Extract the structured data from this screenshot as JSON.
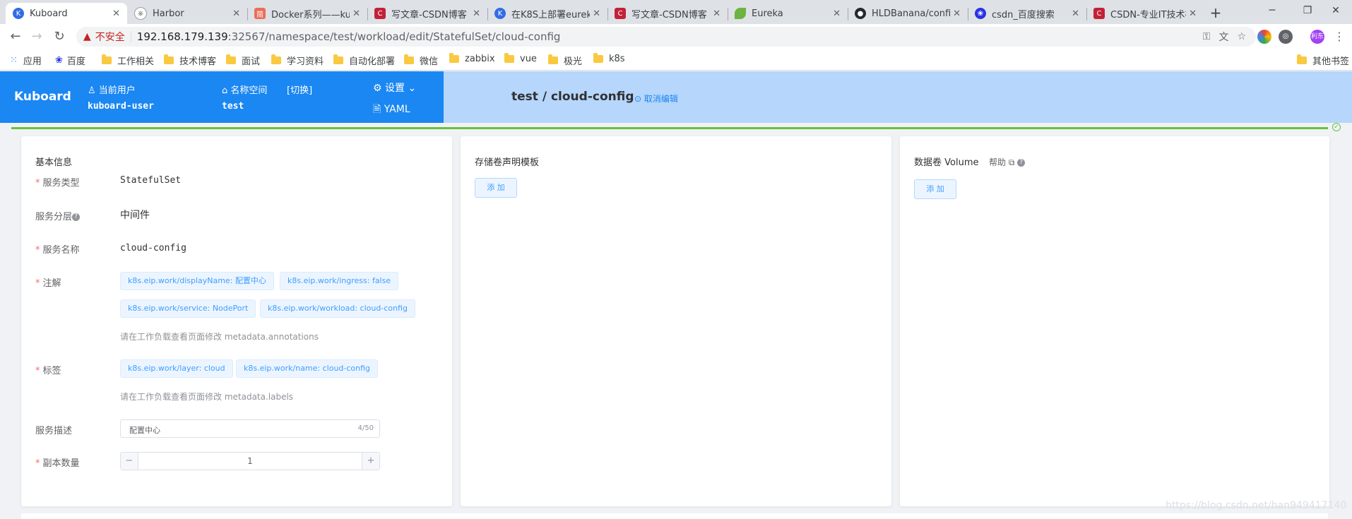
{
  "browser": {
    "tabs": [
      {
        "title": "Kuboard",
        "icon": "kuboard-icon",
        "color": "#326ce5"
      },
      {
        "title": "Harbor",
        "icon": "harbor-icon",
        "color": "#9aa0a6"
      },
      {
        "title": "Docker系列——ku",
        "icon": "jianshu-icon",
        "color": "#ea6f5a"
      },
      {
        "title": "写文章-CSDN博客",
        "icon": "csdn-icon",
        "color": "#c32136"
      },
      {
        "title": "在K8S上部署eurek",
        "icon": "kuboard-icon",
        "color": "#326ce5"
      },
      {
        "title": "写文章-CSDN博客",
        "icon": "csdn-icon",
        "color": "#c32136"
      },
      {
        "title": "Eureka",
        "icon": "spring-leaf-icon",
        "color": "#6db33f"
      },
      {
        "title": "HLDBanana/confi",
        "icon": "github-icon",
        "color": "#24292e"
      },
      {
        "title": "csdn_百度搜索",
        "icon": "baidu-icon",
        "color": "#2932e1"
      },
      {
        "title": "CSDN-专业IT技术社",
        "icon": "csdn-icon",
        "color": "#c32136"
      }
    ],
    "new_tab": "+",
    "insecure_label": "不安全",
    "url_host": "192.168.179.139",
    "url_path": ":32567/namespace/test/workload/edit/StatefulSet/cloud-config",
    "profile_label": "利东",
    "bookmarks": [
      {
        "label": "应用"
      },
      {
        "label": "百度"
      },
      {
        "label": "工作相关"
      },
      {
        "label": "技术博客"
      },
      {
        "label": "面试"
      },
      {
        "label": "学习资料"
      },
      {
        "label": "自动化部署"
      },
      {
        "label": "微信"
      },
      {
        "label": "zabbix"
      },
      {
        "label": "vue"
      },
      {
        "label": "极光"
      },
      {
        "label": "k8s"
      }
    ],
    "other_bookmarks": "其他书签"
  },
  "header": {
    "logo": "Kuboard",
    "current_user_label": "当前用户",
    "current_user": "kuboard-user",
    "namespace_label": "名称空间",
    "switch_label": "[切换]",
    "namespace": "test",
    "settings_label": "设置",
    "yaml_label": "YAML",
    "namespace_path": "test",
    "path_sep": "/",
    "workload_name": "cloud-config",
    "cancel_edit": "取消编辑",
    "accent": "#1a87f2"
  },
  "basic_info": {
    "title": "基本信息",
    "service_type_label": "服务类型",
    "service_type": "StatefulSet",
    "service_layer_label": "服务分层",
    "service_layer": "中间件",
    "service_name_label": "服务名称",
    "service_name": "cloud-config",
    "annotations_label": "注解",
    "annotations": [
      "k8s.eip.work/displayName: 配置中心",
      "k8s.eip.work/ingress: false",
      "k8s.eip.work/service: NodePort",
      "k8s.eip.work/workload: cloud-config"
    ],
    "annotations_hint": "请在工作负载查看页面修改 metadata.annotations",
    "labels_label": "标签",
    "labels": [
      "k8s.eip.work/layer: cloud",
      "k8s.eip.work/name: cloud-config"
    ],
    "labels_hint": "请在工作负载查看页面修改 metadata.labels",
    "description_label": "服务描述",
    "description": "配置中心",
    "description_count": "4/50",
    "replicas_label": "副本数量",
    "replicas": "1"
  },
  "pvc_templates": {
    "title": "存储卷声明模板",
    "add_label": "添 加"
  },
  "volumes": {
    "title": "数据卷 Volume",
    "help_label": "帮助",
    "add_label": "添 加"
  },
  "watermark": "https://blog.csdn.net/han949417140"
}
